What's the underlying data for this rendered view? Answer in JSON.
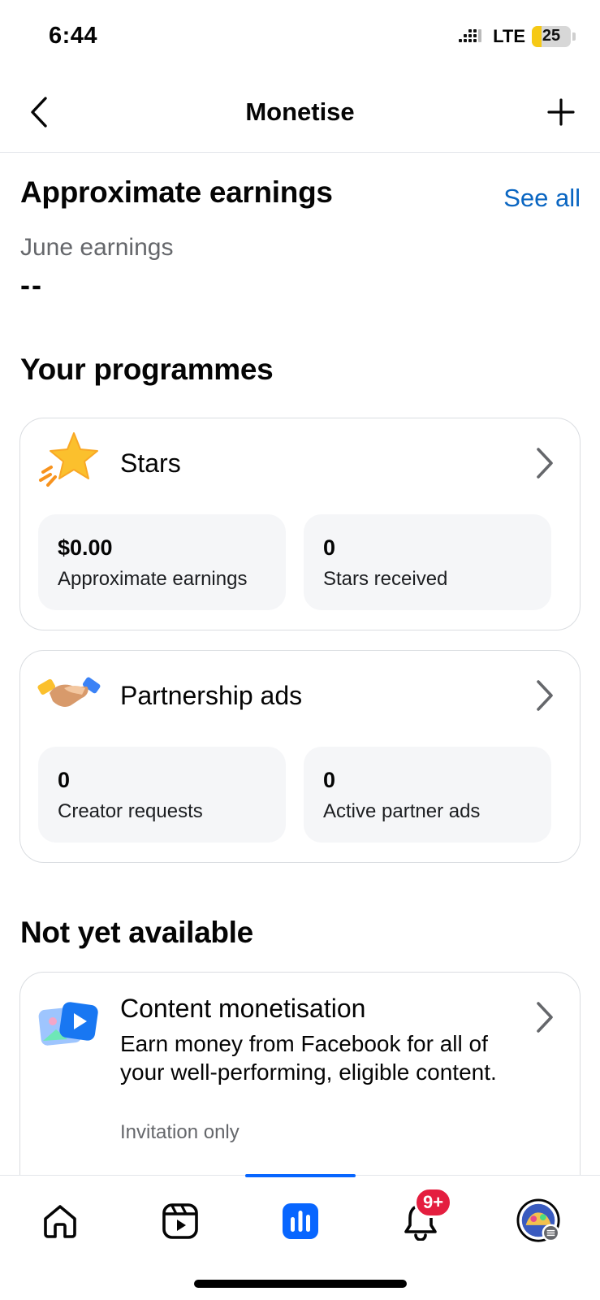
{
  "status_bar": {
    "time": "6:44",
    "network": "LTE",
    "battery": "25",
    "battery_level_percent": 25
  },
  "header": {
    "title": "Monetise",
    "back_icon": "chevron-left-icon",
    "add_icon": "plus-icon"
  },
  "earnings": {
    "heading": "Approximate earnings",
    "see_all": "See all",
    "month_label": "June earnings",
    "month_value": "--"
  },
  "programmes": {
    "heading": "Your programmes",
    "cards": [
      {
        "title": "Stars",
        "icon": "star-icon",
        "stats": [
          {
            "value": "$0.00",
            "label": "Approximate earnings"
          },
          {
            "value": "0",
            "label": "Stars received"
          }
        ]
      },
      {
        "title": "Partnership ads",
        "icon": "handshake-icon",
        "stats": [
          {
            "value": "0",
            "label": "Creator requests"
          },
          {
            "value": "0",
            "label": "Active partner ads"
          }
        ]
      }
    ]
  },
  "not_available": {
    "heading": "Not yet available",
    "card": {
      "title": "Content monetisation",
      "icon": "content-media-icon",
      "description": "Earn money from Facebook for all of your well-performing, eligible content.",
      "note": "Invitation only"
    }
  },
  "bottom_nav": {
    "items": [
      {
        "name": "home",
        "icon": "home-icon"
      },
      {
        "name": "video",
        "icon": "video-icon"
      },
      {
        "name": "dashboard",
        "icon": "bar-chart-icon",
        "active": true
      },
      {
        "name": "notifications",
        "icon": "bell-icon",
        "badge": "9+"
      },
      {
        "name": "profile",
        "icon": "avatar-icon"
      }
    ]
  },
  "colors": {
    "link": "#0a66c2",
    "accent": "#0866ff",
    "badge": "#e41e3f",
    "secondary_text": "#65676b"
  }
}
